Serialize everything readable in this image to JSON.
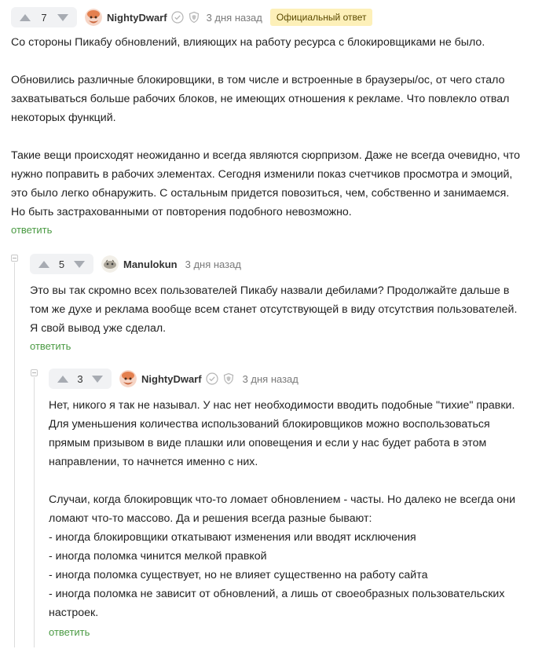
{
  "reply_label": "ответить",
  "comments": [
    {
      "votes": "7",
      "username": "NightyDwarf",
      "timestamp": "3 дня назад",
      "badge": "Официальный ответ",
      "paragraphs": [
        "Со стороны Пикабу обновлений, влияющих на работу ресурса с блокировщиками не было.",
        "Обновились различные блокировщики, в том числе и встроенные в браузеры/ос, от чего стало захватываться больше рабочих блоков, не имеющих отношения к рекламе. Что повлекло отвал некоторых функций.",
        "Такие вещи происходят неожиданно и всегда являются сюрпризом. Даже не всегда очевидно, что нужно поправить в рабочих элементах. Сегодня изменили показ счетчиков просмотра и эмоций, это было легко обнаружить. С остальным придется повозиться, чем, собственно и занимаемся. Но быть застрахованными от повторения подобного невозможно."
      ]
    },
    {
      "votes": "5",
      "username": "Manulokun",
      "timestamp": "3 дня назад",
      "paragraphs": [
        "Это вы так скромно всех пользователей Пикабу назвали дебилами? Продолжайте дальше в том же духе и реклама вообще всем станет отсутствующей в виду отсутствия пользователей. Я свой вывод уже сделал."
      ]
    },
    {
      "votes": "3",
      "username": "NightyDwarf",
      "timestamp": "3 дня назад",
      "paragraphs": [
        "Нет, никого я так не называл. У нас нет необходимости вводить подобные \"тихие\" правки. Для уменьшения количества использований блокировщиков можно воспользоваться прямым призывом в виде плашки или оповещения и если у нас будет работа в этом направлении, то начнется именно с них.",
        "Случаи, когда блокировщик что-то ломает обновлением - часты. Но далеко не всегда они ломают что-то массово. Да и решения всегда разные бывают:\n- иногда блокировщики откатывают изменения или вводят исключения\n- иногда поломка чинится мелкой правкой\n- иногда поломка существует, но не влияет существенно на работу сайта\n- иногда поломка не зависит от обновлений, а лишь от своеобразных пользовательских настроек."
      ]
    }
  ]
}
